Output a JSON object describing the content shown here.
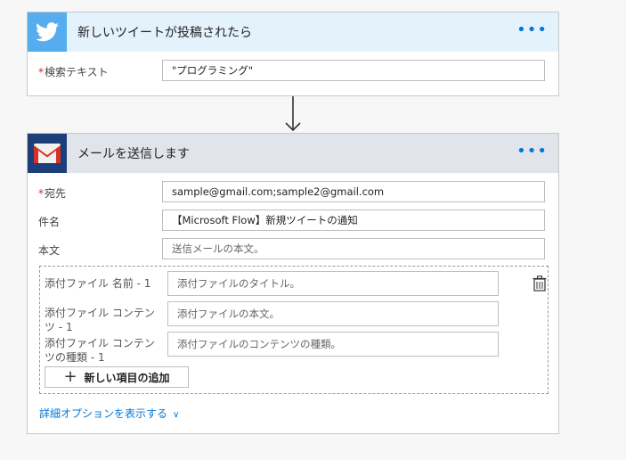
{
  "trigger": {
    "title": "新しいツイートが投稿されたら",
    "logo_icon": "twitter-bird-icon",
    "more_label": "•••",
    "fields": [
      {
        "label": "検索テキスト",
        "required": "*",
        "value": "\"プログラミング\""
      }
    ]
  },
  "action": {
    "title": "メールを送信します",
    "logo_icon": "gmail-icon",
    "more_label": "•••",
    "fields": [
      {
        "label": "宛先",
        "required": "*",
        "value": "sample@gmail.com;sample2@gmail.com",
        "placeholder": ""
      },
      {
        "label": "件名",
        "value": "【Microsoft Flow】新規ツイートの通知",
        "placeholder": ""
      },
      {
        "label": "本文",
        "value": "",
        "placeholder": "送信メールの本文。"
      }
    ],
    "attachments": [
      {
        "label": "添付ファイル 名前 - 1",
        "placeholder": "添付ファイルのタイトル。"
      },
      {
        "label": "添付ファイル コンテンツ - 1",
        "placeholder": "添付ファイルの本文。"
      },
      {
        "label": "添付ファイル コンテンツの種類 - 1",
        "placeholder": "添付ファイルのコンテンツの種類。"
      }
    ],
    "add_item_label": "新しい項目の追加",
    "advanced_options_label": "詳細オプションを表示する"
  },
  "colors": {
    "twitter_header": "#e4f2fc",
    "twitter_logo": "#55acee",
    "gmail_header": "#e1e4ea",
    "gmail_logo": "#1c3f7a",
    "link": "#0078d7",
    "required": "#d62b2b"
  }
}
